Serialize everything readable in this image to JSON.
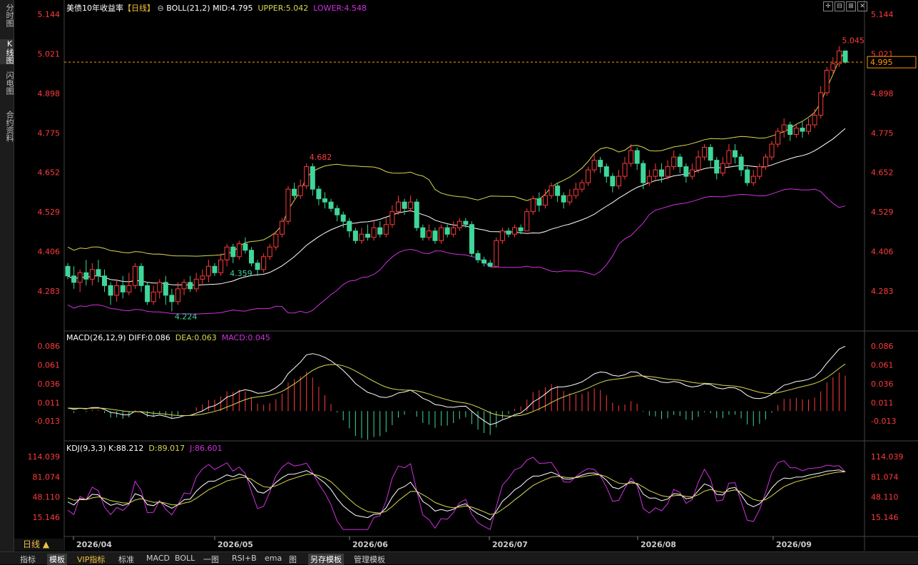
{
  "sidebar": {
    "tabs": [
      {
        "label": "分时图",
        "active": false
      },
      {
        "label": "K线图",
        "active": true
      },
      {
        "label": "闪电图",
        "active": false
      },
      {
        "label": "合约资料",
        "active": false
      }
    ]
  },
  "header": {
    "title": "美债10年收益率",
    "period_tag": "【日线】",
    "indicator": "BOLL(21,2)",
    "mid": "MID:4.795",
    "upper": "UPPER:5.042",
    "lower": "LOWER:4.548"
  },
  "macd_header": {
    "name": "MACD(26,12,9)",
    "diff": "DIFF:0.086",
    "dea": "DEA:0.063",
    "macd": "MACD:0.045"
  },
  "kdj_header": {
    "name": "KDJ(9,3,3)",
    "k": "K:88.212",
    "d": "D:89.017",
    "j": "J:86.601"
  },
  "period_button": "日线 ▲",
  "current_price": "4.995",
  "colors": {
    "up": "#ff3b3b",
    "down": "#3fd69a",
    "upper": "#d8d850",
    "mid": "#ffffff",
    "lower": "#d030e0",
    "diff": "#ffffff",
    "dea": "#d8d850",
    "j": "#d030e0",
    "axis": "#ff3b3b"
  },
  "bottom_tabs": [
    {
      "label": "指标",
      "style": ""
    },
    {
      "label": "模板",
      "style": "sel"
    },
    {
      "label": "VIP指标",
      "style": "vip"
    },
    {
      "label": "标准",
      "style": ""
    },
    {
      "label": "MACD",
      "style": ""
    },
    {
      "label": "BOLL",
      "style": ""
    },
    {
      "label": "一图",
      "style": ""
    },
    {
      "label": "RSI+B",
      "style": ""
    },
    {
      "label": "ema",
      "style": ""
    },
    {
      "label": "图",
      "style": ""
    },
    {
      "label": "另存模板",
      "style": "sel"
    },
    {
      "label": "管理模板",
      "style": ""
    }
  ],
  "chart_data": [
    {
      "type": "candlestick",
      "title": "美债10年收益率",
      "y_ticks": [
        "5.144",
        "5.021",
        "4.898",
        "4.775",
        "4.652",
        "4.529",
        "4.406",
        "4.283"
      ],
      "ylim": [
        4.2,
        5.16
      ],
      "x_ticks": [
        "2026/04",
        "2026/05",
        "2026/06",
        "2026/07",
        "2026/08",
        "2026/09"
      ],
      "annotations": [
        {
          "text": "5.045",
          "value": 5.045,
          "kind": "high"
        },
        {
          "text": "4.682",
          "value": 4.682,
          "kind": "high"
        },
        {
          "text": "4.224",
          "value": 4.224,
          "kind": "low"
        },
        {
          "text": "4.359",
          "value": 4.359,
          "kind": "low"
        }
      ],
      "last_price": 4.995,
      "ohlc": [
        [
          4.36,
          4.33,
          4.37,
          4.32
        ],
        [
          4.33,
          4.31,
          4.36,
          4.29
        ],
        [
          4.31,
          4.34,
          4.35,
          4.28
        ],
        [
          4.34,
          4.32,
          4.38,
          4.3
        ],
        [
          4.32,
          4.35,
          4.37,
          4.3
        ],
        [
          4.35,
          4.33,
          4.38,
          4.31
        ],
        [
          4.33,
          4.3,
          4.35,
          4.28
        ],
        [
          4.3,
          4.27,
          4.31,
          4.24
        ],
        [
          4.27,
          4.3,
          4.32,
          4.25
        ],
        [
          4.3,
          4.28,
          4.33,
          4.26
        ],
        [
          4.28,
          4.3,
          4.34,
          4.27
        ],
        [
          4.3,
          4.36,
          4.37,
          4.29
        ],
        [
          4.36,
          4.3,
          4.37,
          4.28
        ],
        [
          4.3,
          4.25,
          4.31,
          4.24
        ],
        [
          4.25,
          4.28,
          4.3,
          4.24
        ],
        [
          4.28,
          4.31,
          4.32,
          4.26
        ],
        [
          4.31,
          4.27,
          4.33,
          4.24
        ],
        [
          4.27,
          4.25,
          4.29,
          4.22
        ],
        [
          4.25,
          4.29,
          4.31,
          4.24
        ],
        [
          4.29,
          4.31,
          4.32,
          4.27
        ],
        [
          4.31,
          4.29,
          4.33,
          4.28
        ],
        [
          4.29,
          4.32,
          4.34,
          4.28
        ],
        [
          4.32,
          4.33,
          4.35,
          4.3
        ],
        [
          4.33,
          4.36,
          4.38,
          4.31
        ],
        [
          4.36,
          4.34,
          4.37,
          4.33
        ],
        [
          4.34,
          4.38,
          4.4,
          4.33
        ],
        [
          4.38,
          4.42,
          4.43,
          4.36
        ],
        [
          4.42,
          4.39,
          4.43,
          4.37
        ],
        [
          4.39,
          4.43,
          4.44,
          4.38
        ],
        [
          4.43,
          4.41,
          4.45,
          4.4
        ],
        [
          4.41,
          4.37,
          4.42,
          4.36
        ],
        [
          4.37,
          4.35,
          4.38,
          4.33
        ],
        [
          4.35,
          4.39,
          4.4,
          4.34
        ],
        [
          4.39,
          4.42,
          4.43,
          4.38
        ],
        [
          4.42,
          4.46,
          4.47,
          4.41
        ],
        [
          4.46,
          4.5,
          4.51,
          4.45
        ],
        [
          4.5,
          4.6,
          4.61,
          4.49
        ],
        [
          4.6,
          4.58,
          4.62,
          4.57
        ],
        [
          4.58,
          4.61,
          4.63,
          4.57
        ],
        [
          4.61,
          4.67,
          4.68,
          4.6
        ],
        [
          4.67,
          4.6,
          4.68,
          4.58
        ],
        [
          4.6,
          4.57,
          4.61,
          4.55
        ],
        [
          4.57,
          4.56,
          4.59,
          4.54
        ],
        [
          4.56,
          4.54,
          4.57,
          4.53
        ],
        [
          4.54,
          4.52,
          4.55,
          4.5
        ],
        [
          4.52,
          4.5,
          4.53,
          4.48
        ],
        [
          4.5,
          4.47,
          4.51,
          4.45
        ],
        [
          4.47,
          4.44,
          4.48,
          4.43
        ],
        [
          4.44,
          4.46,
          4.48,
          4.43
        ],
        [
          4.46,
          4.45,
          4.49,
          4.44
        ],
        [
          4.45,
          4.48,
          4.5,
          4.44
        ],
        [
          4.48,
          4.46,
          4.5,
          4.45
        ],
        [
          4.46,
          4.49,
          4.51,
          4.45
        ],
        [
          4.49,
          4.53,
          4.55,
          4.48
        ],
        [
          4.53,
          4.56,
          4.58,
          4.52
        ],
        [
          4.56,
          4.54,
          4.57,
          4.52
        ],
        [
          4.54,
          4.56,
          4.58,
          4.53
        ],
        [
          4.56,
          4.48,
          4.57,
          4.47
        ],
        [
          4.48,
          4.45,
          4.49,
          4.44
        ],
        [
          4.45,
          4.47,
          4.49,
          4.44
        ],
        [
          4.47,
          4.44,
          4.48,
          4.43
        ],
        [
          4.44,
          4.48,
          4.49,
          4.43
        ],
        [
          4.48,
          4.46,
          4.49,
          4.45
        ],
        [
          4.46,
          4.48,
          4.5,
          4.45
        ],
        [
          4.48,
          4.5,
          4.51,
          4.47
        ],
        [
          4.5,
          4.49,
          4.51,
          4.48
        ],
        [
          4.49,
          4.4,
          4.5,
          4.39
        ],
        [
          4.4,
          4.38,
          4.41,
          4.37
        ],
        [
          4.38,
          4.37,
          4.39,
          4.36
        ],
        [
          4.37,
          4.36,
          4.38,
          4.36
        ],
        [
          4.36,
          4.44,
          4.45,
          4.36
        ],
        [
          4.44,
          4.47,
          4.48,
          4.43
        ],
        [
          4.47,
          4.46,
          4.48,
          4.45
        ],
        [
          4.46,
          4.48,
          4.49,
          4.45
        ],
        [
          4.48,
          4.47,
          4.49,
          4.46
        ],
        [
          4.47,
          4.53,
          4.54,
          4.47
        ],
        [
          4.53,
          4.57,
          4.58,
          4.52
        ],
        [
          4.57,
          4.55,
          4.59,
          4.53
        ],
        [
          4.55,
          4.58,
          4.6,
          4.54
        ],
        [
          4.58,
          4.61,
          4.62,
          4.57
        ],
        [
          4.61,
          4.58,
          4.62,
          4.56
        ],
        [
          4.58,
          4.56,
          4.59,
          4.54
        ],
        [
          4.56,
          4.58,
          4.6,
          4.55
        ],
        [
          4.58,
          4.6,
          4.62,
          4.57
        ],
        [
          4.6,
          4.62,
          4.63,
          4.59
        ],
        [
          4.62,
          4.66,
          4.67,
          4.61
        ],
        [
          4.66,
          4.69,
          4.71,
          4.65
        ],
        [
          4.69,
          4.67,
          4.7,
          4.65
        ],
        [
          4.67,
          4.64,
          4.68,
          4.62
        ],
        [
          4.64,
          4.61,
          4.65,
          4.59
        ],
        [
          4.61,
          4.64,
          4.66,
          4.6
        ],
        [
          4.64,
          4.68,
          4.7,
          4.63
        ],
        [
          4.68,
          4.72,
          4.74,
          4.67
        ],
        [
          4.72,
          4.68,
          4.73,
          4.66
        ],
        [
          4.68,
          4.62,
          4.69,
          4.6
        ],
        [
          4.62,
          4.64,
          4.66,
          4.61
        ],
        [
          4.64,
          4.66,
          4.68,
          4.63
        ],
        [
          4.66,
          4.64,
          4.68,
          4.62
        ],
        [
          4.64,
          4.67,
          4.69,
          4.63
        ],
        [
          4.67,
          4.7,
          4.72,
          4.66
        ],
        [
          4.7,
          4.67,
          4.71,
          4.65
        ],
        [
          4.67,
          4.64,
          4.68,
          4.62
        ],
        [
          4.64,
          4.66,
          4.68,
          4.63
        ],
        [
          4.66,
          4.7,
          4.72,
          4.65
        ],
        [
          4.7,
          4.73,
          4.74,
          4.69
        ],
        [
          4.73,
          4.69,
          4.74,
          4.67
        ],
        [
          4.69,
          4.65,
          4.7,
          4.63
        ],
        [
          4.65,
          4.68,
          4.7,
          4.64
        ],
        [
          4.68,
          4.72,
          4.74,
          4.67
        ],
        [
          4.72,
          4.7,
          4.74,
          4.68
        ],
        [
          4.7,
          4.66,
          4.71,
          4.64
        ],
        [
          4.66,
          4.62,
          4.67,
          4.61
        ],
        [
          4.62,
          4.64,
          4.66,
          4.61
        ],
        [
          4.64,
          4.67,
          4.68,
          4.63
        ],
        [
          4.67,
          4.7,
          4.71,
          4.66
        ],
        [
          4.7,
          4.74,
          4.75,
          4.69
        ],
        [
          4.74,
          4.78,
          4.79,
          4.73
        ],
        [
          4.78,
          4.8,
          4.82,
          4.76
        ],
        [
          4.8,
          4.77,
          4.81,
          4.75
        ],
        [
          4.77,
          4.79,
          4.8,
          4.76
        ],
        [
          4.79,
          4.78,
          4.81,
          4.76
        ],
        [
          4.78,
          4.8,
          4.82,
          4.77
        ],
        [
          4.8,
          4.83,
          4.85,
          4.79
        ],
        [
          4.83,
          4.9,
          4.92,
          4.82
        ],
        [
          4.9,
          4.97,
          4.98,
          4.89
        ],
        [
          4.97,
          4.99,
          5.01,
          4.96
        ],
        [
          4.99,
          5.03,
          5.045,
          4.98
        ],
        [
          5.03,
          4.995,
          5.03,
          4.99
        ]
      ]
    },
    {
      "type": "line+bar",
      "title": "MACD(26,12,9)",
      "y_ticks": [
        "0.086",
        "0.061",
        "0.036",
        "0.011",
        "-0.013"
      ],
      "ylim": [
        -0.03,
        0.095
      ],
      "series": [
        {
          "name": "DIFF",
          "latest": 0.086
        },
        {
          "name": "DEA",
          "latest": 0.063
        },
        {
          "name": "MACD",
          "latest": 0.045
        }
      ]
    },
    {
      "type": "line",
      "title": "KDJ(9,3,3)",
      "y_ticks": [
        "114.039",
        "81.074",
        "48.110",
        "15.146"
      ],
      "ylim": [
        -10,
        125
      ],
      "series": [
        {
          "name": "K",
          "latest": 88.212
        },
        {
          "name": "D",
          "latest": 89.017
        },
        {
          "name": "J",
          "latest": 86.601
        }
      ]
    }
  ]
}
